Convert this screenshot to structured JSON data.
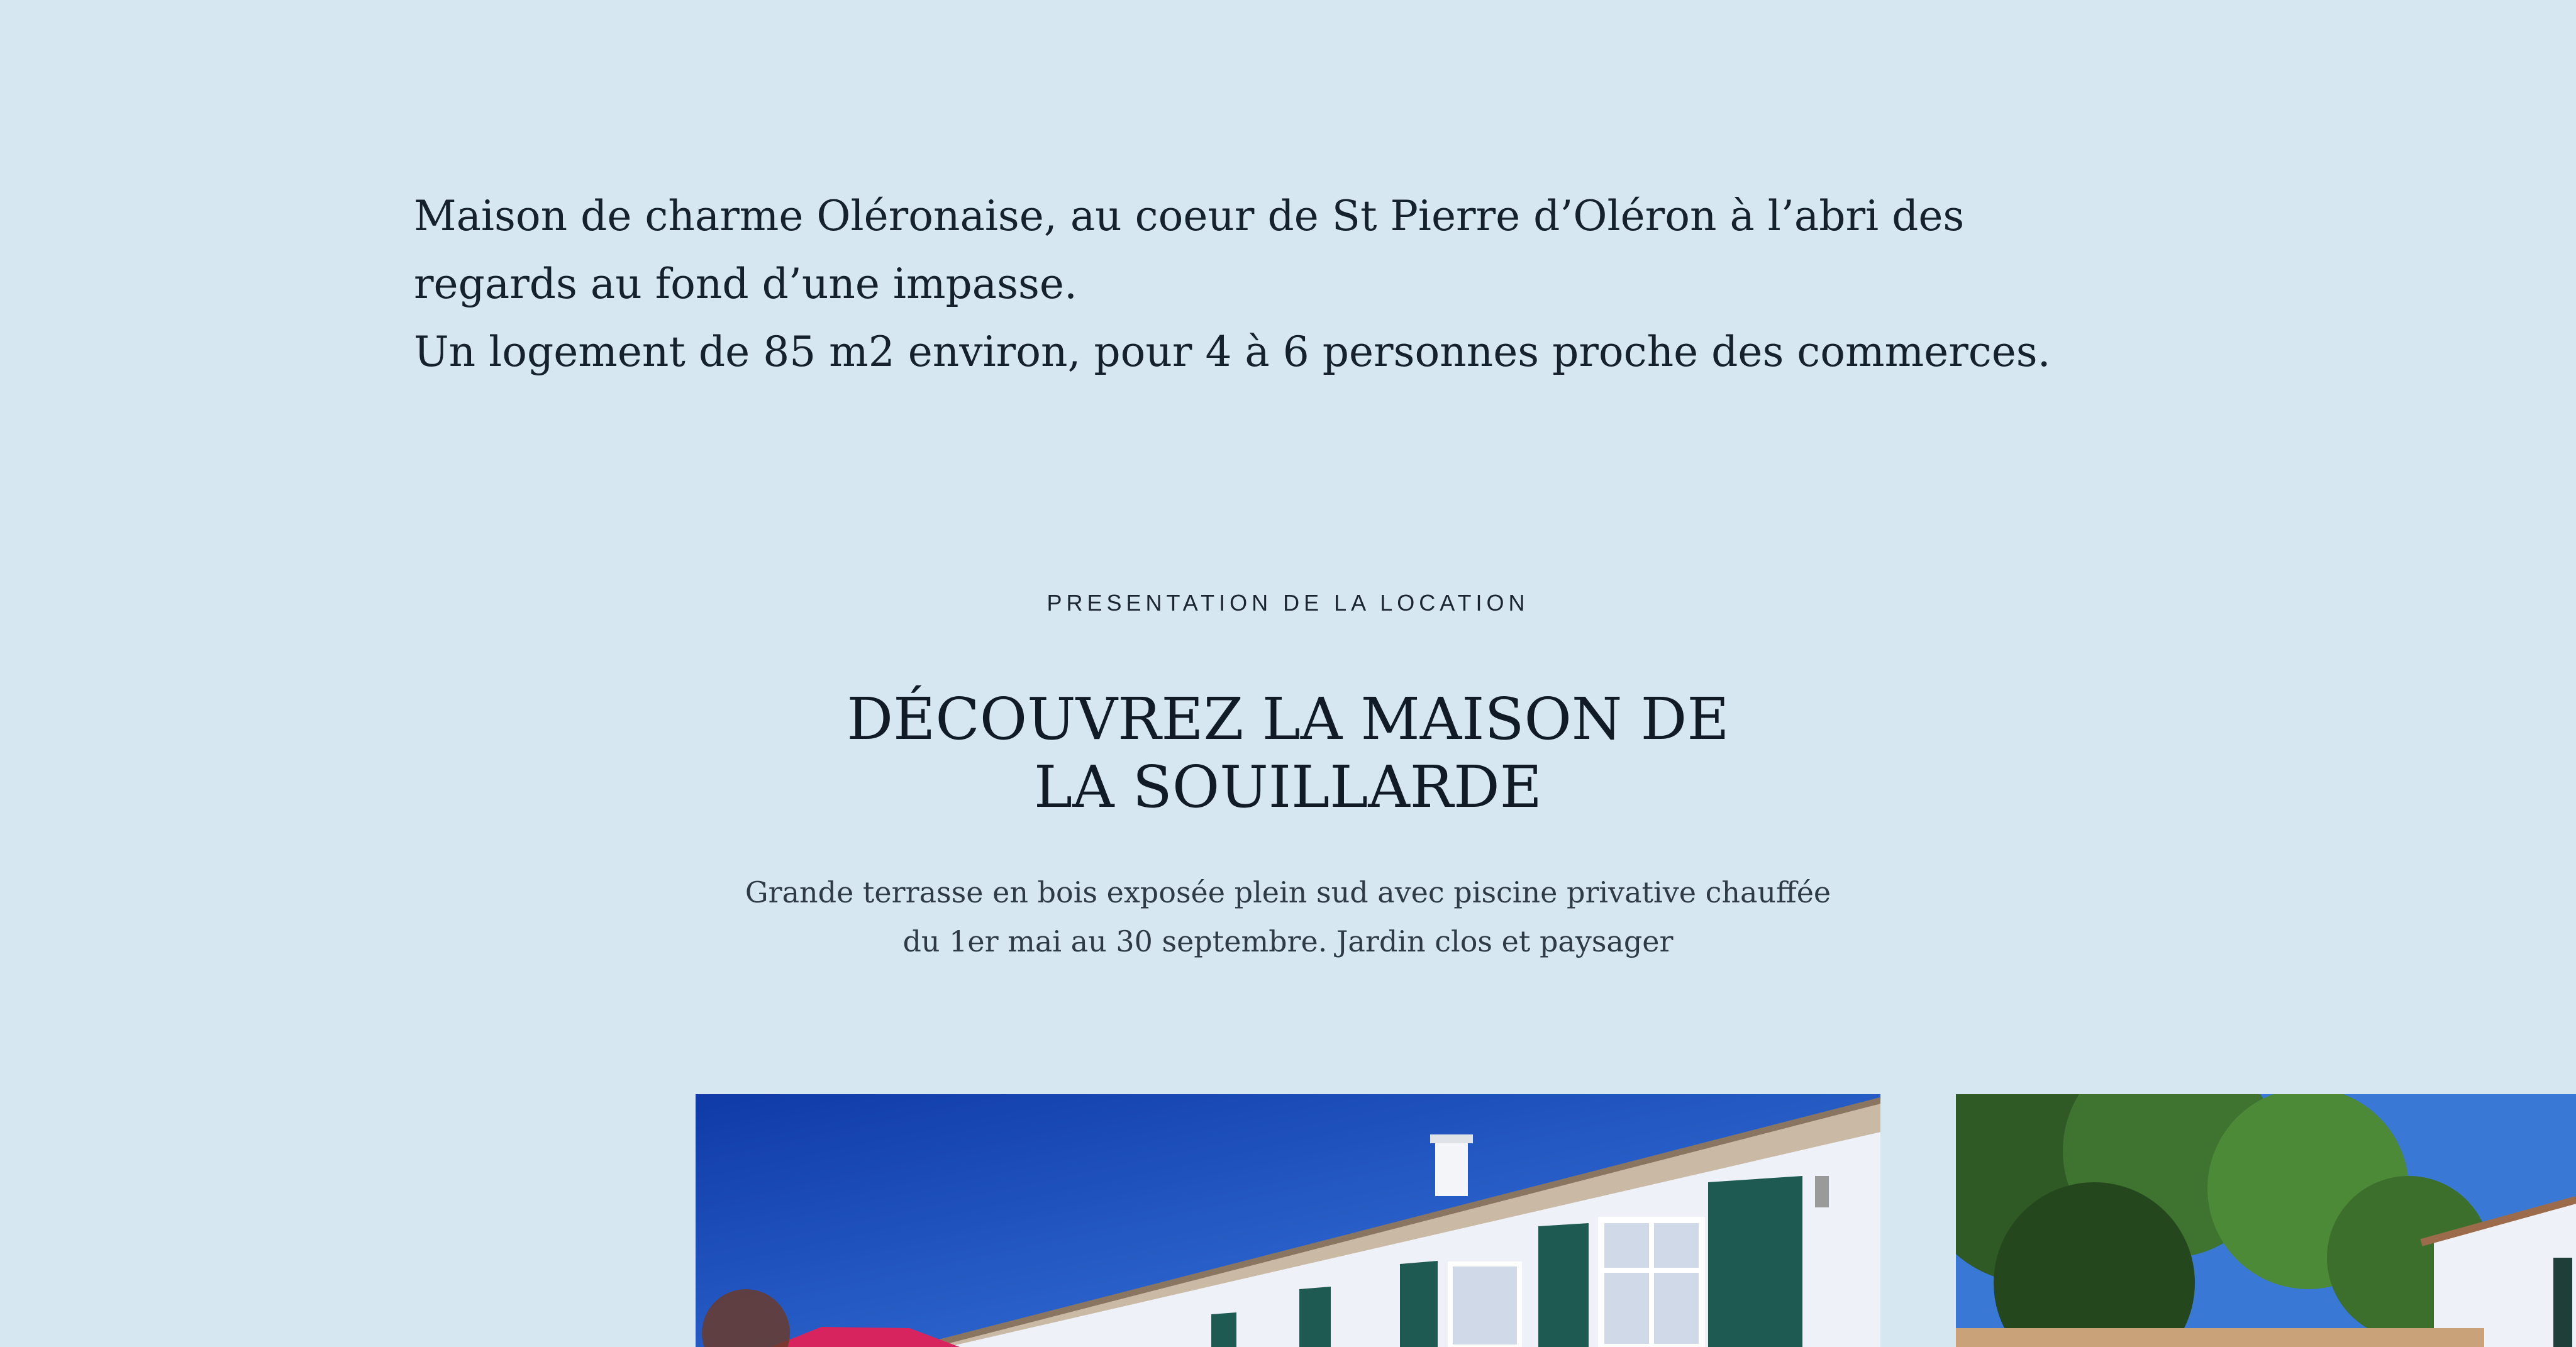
{
  "intro": {
    "line1": "Maison de charme Oléronaise, au coeur de St Pierre d’Oléron à l’abri des regards au fond d’une impasse.",
    "line2": "Un logement de 85 m2 environ, pour 4 à 6 personnes proche des commerces."
  },
  "section": {
    "eyebrow": "PRESENTATION DE LA LOCATION",
    "heading_line1": "DÉCOUVREZ LA MAISON DE",
    "heading_line2": "LA SOUILLARDE",
    "subtitle": "Grande terrasse en bois exposée plein sud avec piscine privative chauffée du 1er mai au 30 septembre. Jardin clos et paysager"
  },
  "colors": {
    "background": "#d6e7f1",
    "text": "#14202b",
    "sky": "#1e4fc4",
    "shutters": "#1f5a52"
  }
}
